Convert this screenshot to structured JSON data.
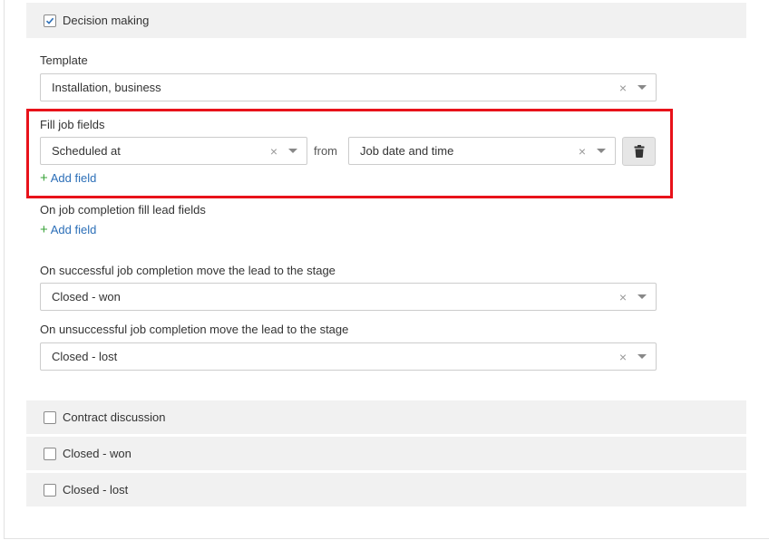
{
  "stages": {
    "top": {
      "label": "Decision making",
      "checked": true
    },
    "bottom": [
      {
        "label": "Contract discussion",
        "checked": false
      },
      {
        "label": "Closed - won",
        "checked": false
      },
      {
        "label": "Closed - lost",
        "checked": false
      }
    ]
  },
  "template": {
    "label": "Template",
    "value": "Installation, business"
  },
  "fill_job_fields": {
    "label": "Fill job fields",
    "job_field": "Scheduled at",
    "from_text": "from",
    "source_field": "Job date and time",
    "add_label": "Add field"
  },
  "completion_fill": {
    "label": "On job completion fill lead fields",
    "add_label": "Add field"
  },
  "success_stage": {
    "label": "On successful job completion move the lead to the stage",
    "value": "Closed - won"
  },
  "fail_stage": {
    "label": "On unsuccessful job completion move the lead to the stage",
    "value": "Closed - lost"
  },
  "icons": {
    "clear": "×",
    "plus": "+"
  },
  "colors": {
    "highlight": "#e8121a",
    "link": "#2c6fb8",
    "plus": "#3aa33a",
    "stage_bg": "#f1f1f1"
  }
}
